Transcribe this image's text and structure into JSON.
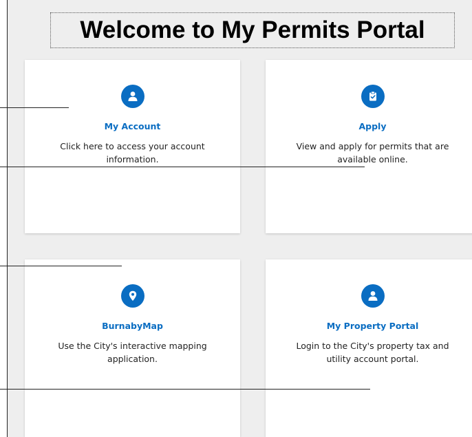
{
  "page": {
    "title": "Welcome to My Permits Portal"
  },
  "cards": [
    {
      "title": "My Account",
      "description": "Click here to access your account information.",
      "icon": "user-icon"
    },
    {
      "title": "Apply",
      "description": "View and apply for permits that are available online.",
      "icon": "clipboard-check-icon"
    },
    {
      "title": "BurnabyMap",
      "description": "Use the City's interactive mapping application.",
      "icon": "map-pin-icon"
    },
    {
      "title": "My Property Portal",
      "description": "Login to the City's property tax and utility account portal.",
      "icon": "user-icon"
    }
  ],
  "colors": {
    "accent": "#0a6dc2",
    "background": "#eeeeee",
    "card": "#ffffff"
  }
}
